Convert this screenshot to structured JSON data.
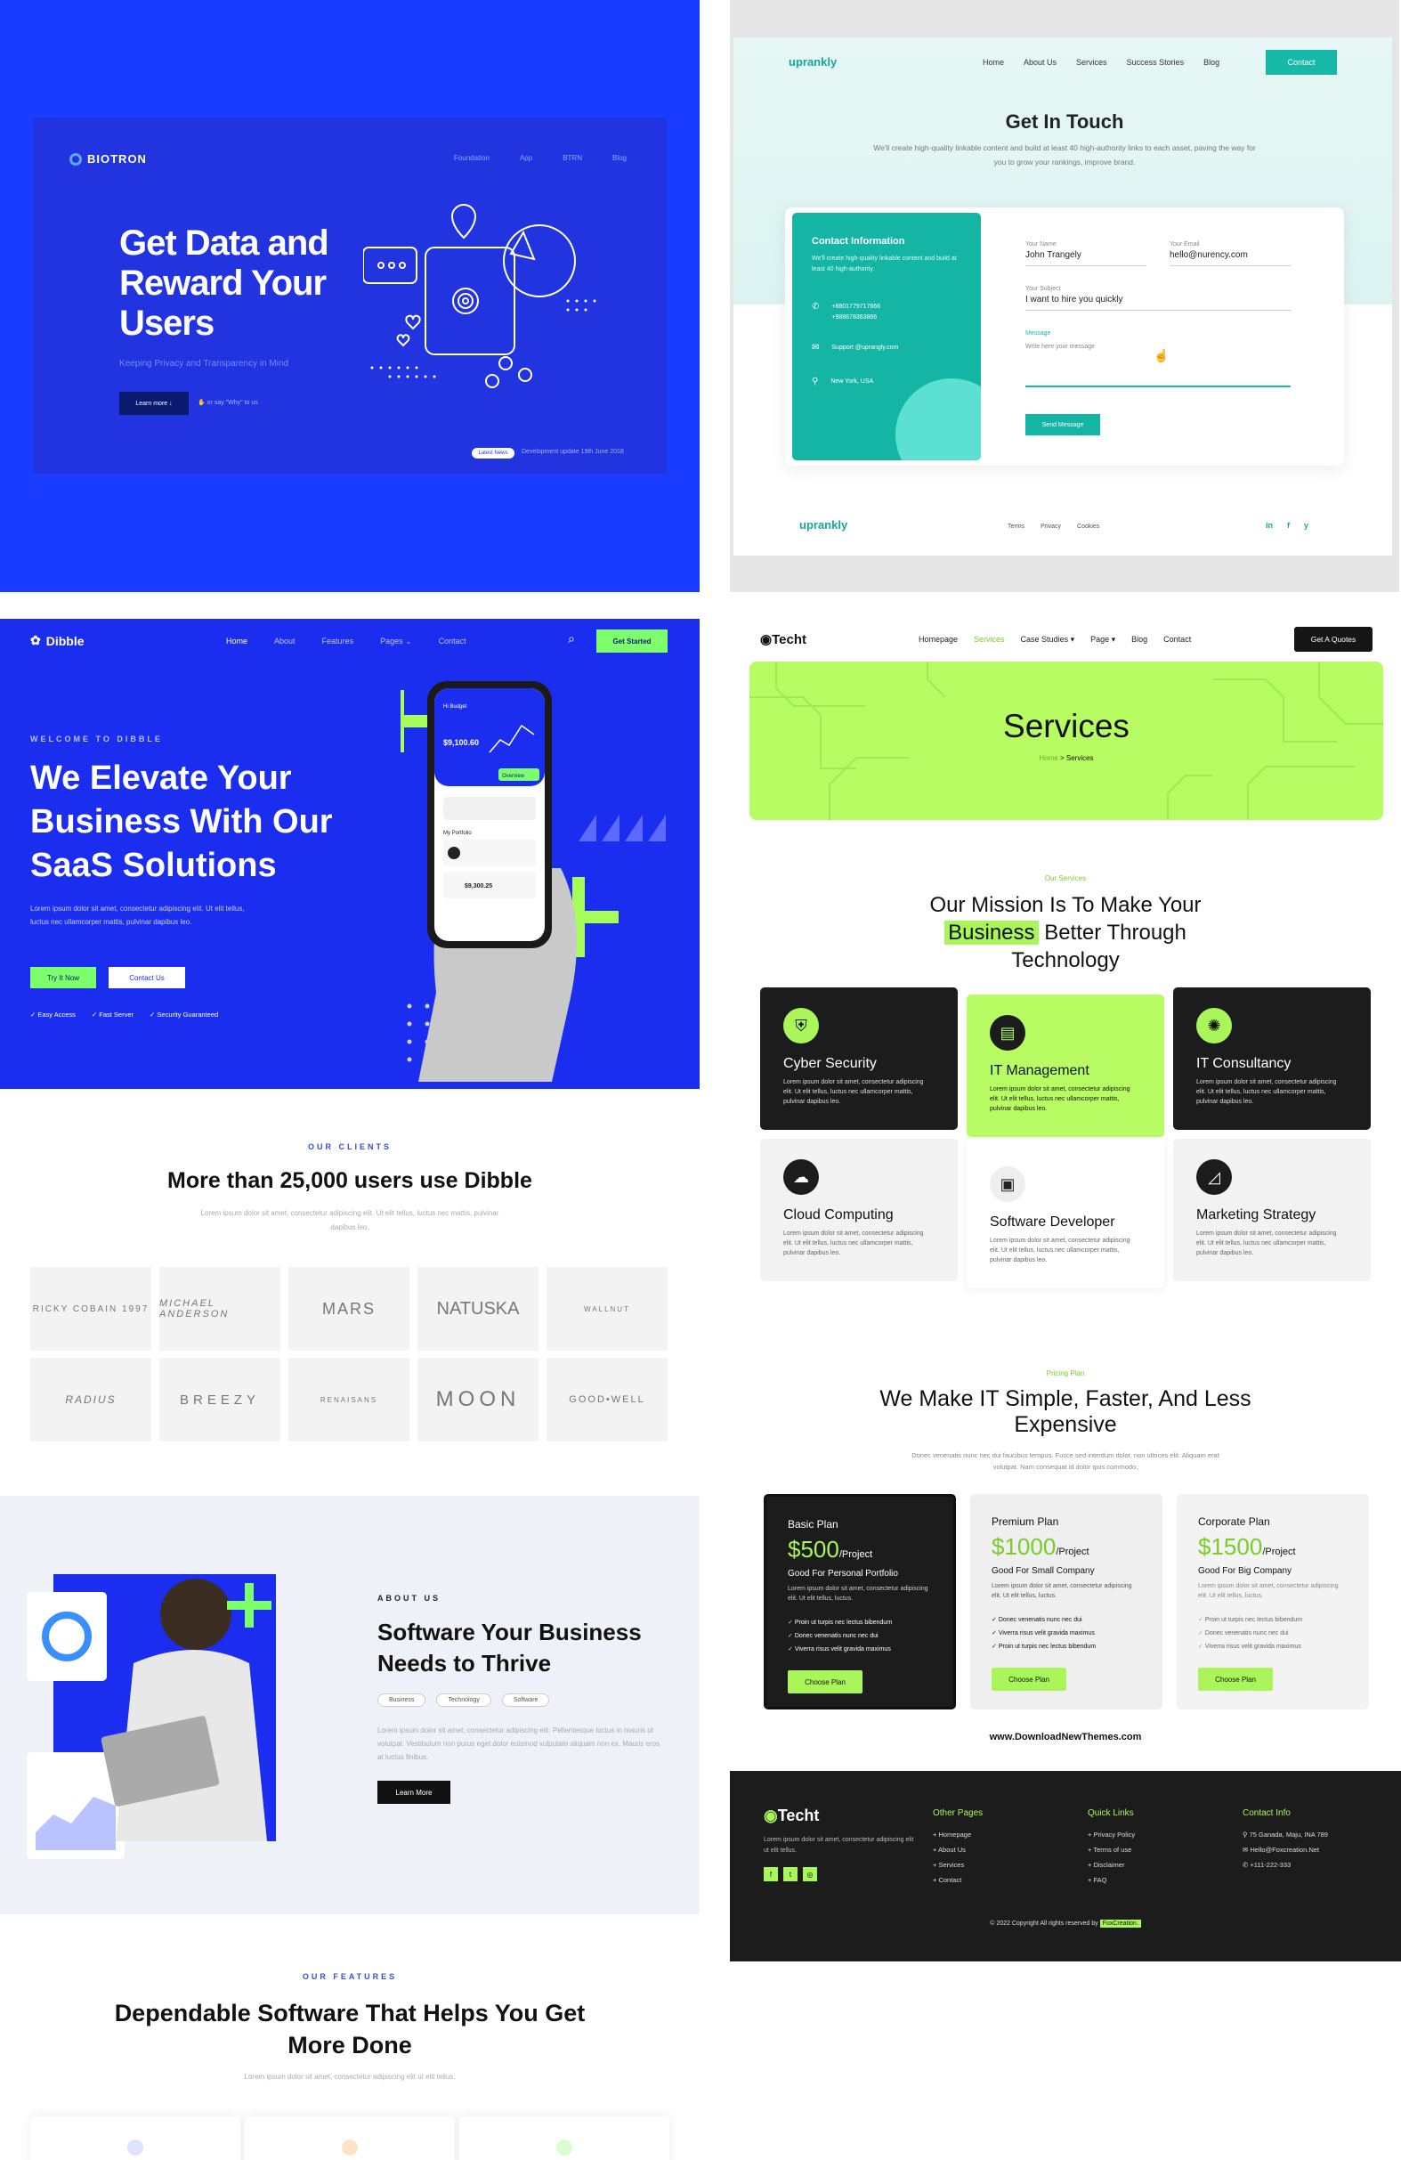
{
  "biotron": {
    "logo": "BIOTRON",
    "nav": [
      "Foundation",
      "App",
      "BTRN",
      "Blog"
    ],
    "title": "Get Data and Reward Your Users",
    "subtitle": "Keeping Privacy and Transparency in Mind",
    "learn_btn": "Learn more ↓",
    "say": "✋ or say \"Why\" to us",
    "badge": "Latest News",
    "update": "Development update 19th June 2018",
    "accent": "#1a3cff"
  },
  "uprankly": {
    "logo": "uprankly",
    "nav": [
      "Home",
      "About Us",
      "Services",
      "Success Stories",
      "Blog"
    ],
    "contact_btn": "Contact",
    "title": "Get In Touch",
    "description": "We'll create high-quality linkable content and build at least 40 high-authority links to each asset, paving the way for you to grow your rankings, improve brand.",
    "info": {
      "title": "Contact Information",
      "desc": "We'll create high-quality linkable content and build at least 40 high-authority.",
      "phone1": "+8801779717666",
      "phone2": "+988678363866",
      "email": "Support @uprangly.com",
      "address": "New York, USA"
    },
    "form": {
      "name_label": "Your Name",
      "name_value": "John Trangely",
      "email_label": "Your Email",
      "email_value": "hello@nurency.com",
      "subject_label": "Your Subject",
      "subject_value": "I want to hire you quickly",
      "message_label": "Message",
      "message_placeholder": "Write here your message",
      "send_btn": "Send Message"
    },
    "footer_logo": "uprankly",
    "footer_links": [
      "Terms",
      "Privacy",
      "Cookies"
    ],
    "social": [
      "in",
      "f",
      "y"
    ],
    "accent": "#17b8a8"
  },
  "dibble": {
    "logo": "Dibble",
    "nav": [
      "Home",
      "About",
      "Features",
      "Pages ⌄",
      "Contact"
    ],
    "get_started": "Get Started",
    "welcome": "WELCOME TO DIBBLE",
    "title": "We Elevate Your Business With Our SaaS Solutions",
    "paragraph": "Lorem ipsum dolor sit amet, consectetur adipiscing elit. Ut elit tellus, luctus nec ullamcorper mattis, pulvinar dapibus leo.",
    "try_btn": "Try It Now",
    "contact_btn": "Contact Us",
    "checks": [
      "✓ Easy Access",
      "✓ Fast Server",
      "✓ Security Guaranteed"
    ],
    "phone": {
      "app": "Hi Budget",
      "balance": "$9,100.60",
      "portfolio": "My Portfolio",
      "amount": "$9,300.25",
      "overview": "Overview"
    },
    "clients_label": "OUR CLIENTS",
    "clients_title": "More than 25,000 users use Dibble",
    "clients_text": "Lorem ipsum dolor sit amet, consectetur adipiscing elit. Ut elit tellus, luctus nec mattis, pulvinar dapibus leo.",
    "client_logos": [
      "RICKY COBAIN 1997",
      "MICHAEL ANDERSON",
      "MARS",
      "NATUSKA",
      "WALLNUT",
      "RADIUS",
      "BREEZY",
      "RENAISANS",
      "MOON",
      "GOOD•WELL"
    ],
    "about_label": "ABOUT US",
    "about_title": "Software Your Business Needs to Thrive",
    "about_tags": [
      "Business",
      "Technology",
      "Software"
    ],
    "about_text": "Lorem ipsum dolor sit amet, consectetur adipiscing elit. Pellentesque luctus in mauris ut volutpat. Vestibulum non purus eget dolor euismod vulputate aliquam non ex. Mauris eros at luctus finibus.",
    "learn_more": "Learn More",
    "features_label": "OUR FEATURES",
    "features_title": "Dependable Software That Helps You Get More Done",
    "features_text": "Lorem ipsum dolor sit amet, consectetur adipiscing elit ut elit tellus.",
    "accent": "#1b2ef0",
    "green": "#7dff6b"
  },
  "techt": {
    "logo": "◉Techt",
    "nav": [
      "Homepage",
      "Services",
      "Case Studies ▾",
      "Page ▾",
      "Blog",
      "Contact"
    ],
    "quote_btn": "Get A Quotes",
    "banner_title": "Services",
    "crumb_home": "Home",
    "crumb_current": " > Services",
    "services_label": "Our Services",
    "mission_line1": "Our Mission Is To Make Your",
    "mission_hl": "Business",
    "mission_line2": " Better Through",
    "mission_line3": "Technology",
    "services": [
      {
        "title": "Cyber Security",
        "desc": "Lorem ipsum dolor sit amet, consectetur adipiscing elit. Ut elit tellus, luctus nec ullamcorper mattis, pulvinar dapibus leo.",
        "icon": "shield-icon"
      },
      {
        "title": "IT Management",
        "desc": "Lorem ipsum dolor sit amet, consectetur adipiscing elit. Ut elit tellus, luctus nec ullamcorper mattis, pulvinar dapibus leo.",
        "icon": "server-icon"
      },
      {
        "title": "IT Consultancy",
        "desc": "Lorem ipsum dolor sit amet, consectetur adipiscing elit. Ut elit tellus, luctus nec ullamcorper mattis, pulvinar dapibus leo.",
        "icon": "consult-icon"
      },
      {
        "title": "Cloud Computing",
        "desc": "Lorem ipsum dolor sit amet, consectetur adipiscing elit. Ut elit tellus, luctus nec ullamcorper mattis, pulvinar dapibus leo.",
        "icon": "cloud-icon"
      },
      {
        "title": "Software Developer",
        "desc": "Lorem ipsum dolor sit amet, consectetur adipiscing elit. Ut elit tellus, luctus nec ullamcorper mattis, pulvinar dapibus leo.",
        "icon": "monitor-icon"
      },
      {
        "title": "Marketing Strategy",
        "desc": "Lorem ipsum dolor sit amet, consectetur adipiscing elit. Ut elit tellus, luctus nec ullamcorper mattis, pulvinar dapibus leo.",
        "icon": "chart-icon"
      }
    ],
    "pricing_label": "Pricing Plan",
    "pricing_title": "We Make IT Simple, Faster, And Less Expensive",
    "pricing_text": "Donec venenatis nunc nec dui faucibus tempus. Fusce sed interdum dolor, non ultrices elit. Aliquam erat volutpat. Nam consequat id dolor quis commodo.",
    "plans": [
      {
        "name": "Basic Plan",
        "price": "$500",
        "unit": "/Project",
        "for": "Good For Personal Portfolio",
        "desc": "Lorem ipsum dolor sit amet, consectetur adipiscing elit. Ut elit tellus, luctus.",
        "features": [
          "Proin ut turpis nec lectus bibendum",
          "Donec venenatis nunc nec dui",
          "Viverra risus velit gravida maximus"
        ],
        "btn": "Choose Plan"
      },
      {
        "name": "Premium Plan",
        "price": "$1000",
        "unit": "/Project",
        "for": "Good For Small Company",
        "desc": "Lorem ipsum dolor sit amet, consectetur adipiscing elit. Ut elit tellus, luctus.",
        "features": [
          "Donec venenatis nunc nec dui",
          "Viverra risus velit gravida maximus",
          "Proin ut turpis nec lectus bibendum"
        ],
        "btn": "Choose Plan"
      },
      {
        "name": "Corporate Plan",
        "price": "$1500",
        "unit": "/Project",
        "for": "Good For Big Company",
        "desc": "Lorem ipsum dolor sit amet, consectetur adipiscing elit. Ut elit tellus, luctus.",
        "features": [
          "Proin ut turpis nec lectus bibendum",
          "Donec venenatis nunc nec dui",
          "Viverra risus velit gravida maximus"
        ],
        "btn": "Choose Plan"
      }
    ],
    "watermark": "www.DownloadNewThemes.com",
    "footer": {
      "logo": "Techt",
      "desc": "Lorem ipsum dolor sit amet, consectetur adipiscing elit ut elit tellus.",
      "other_pages_title": "Other Pages",
      "other_pages": [
        "+ Homepage",
        "+ About Us",
        "+ Services",
        "+ Contact"
      ],
      "quick_links_title": "Quick Links",
      "quick_links": [
        "+ Privacy Policy",
        "+ Terms of use",
        "+ Disclaimer",
        "+ FAQ"
      ],
      "contact_title": "Contact Info",
      "contact": [
        "⚲ 75 Ganada, Maju, INA 789",
        "✉ Hello@Foxcreation.Net",
        "✆ +111-222-333"
      ],
      "copyright": "© 2022 Copyright All rights reserved by ",
      "copyright_brand": "FoxCreation."
    },
    "accent": "#a9f55a"
  }
}
